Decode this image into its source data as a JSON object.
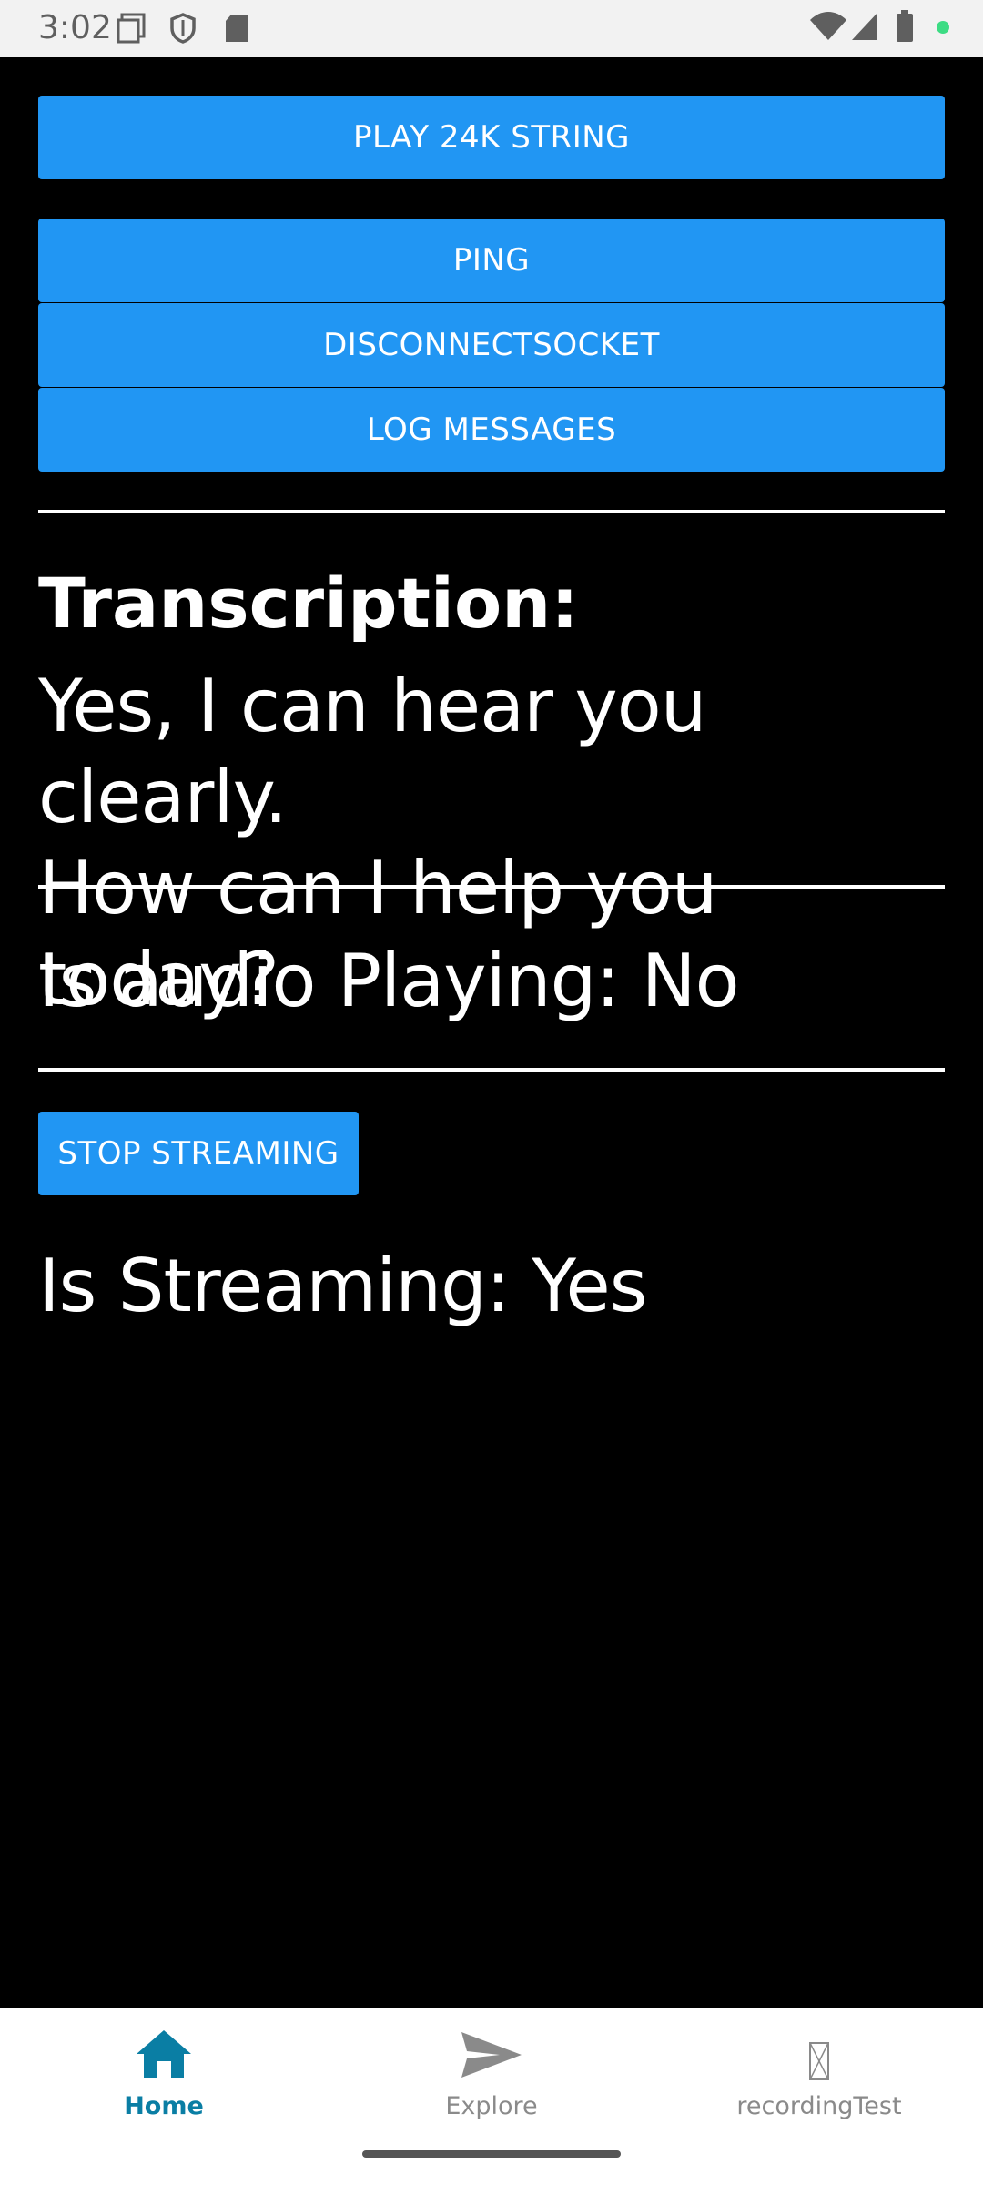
{
  "status_bar": {
    "time": "3:02",
    "icons": [
      "screen-icon",
      "shield-icon",
      "sd-card-icon",
      "wifi-icon",
      "signal-icon",
      "battery-icon",
      "dot-icon"
    ],
    "dot_color": "#3ddc84"
  },
  "buttons": {
    "play_label": "PLAY 24K STRING",
    "ping_label": "PING",
    "disconnect_label": "DISCONNECTSOCKET",
    "log_label": "LOG MESSAGES",
    "stop_label": "STOP STREAMING"
  },
  "transcription": {
    "label": "Transcription:",
    "line1": "Yes, I can hear you clearly.",
    "line2": "How can I help you today?"
  },
  "audio": {
    "status": "Is audio Playing: No"
  },
  "streaming": {
    "status": "Is Streaming: Yes"
  },
  "nav": {
    "home": "Home",
    "explore": "Explore",
    "recording": "recordingTest",
    "active_color": "#0a7ea4",
    "inactive_color": "#8a8a8a"
  },
  "colors": {
    "accent": "#2196f3",
    "background": "#000000"
  }
}
